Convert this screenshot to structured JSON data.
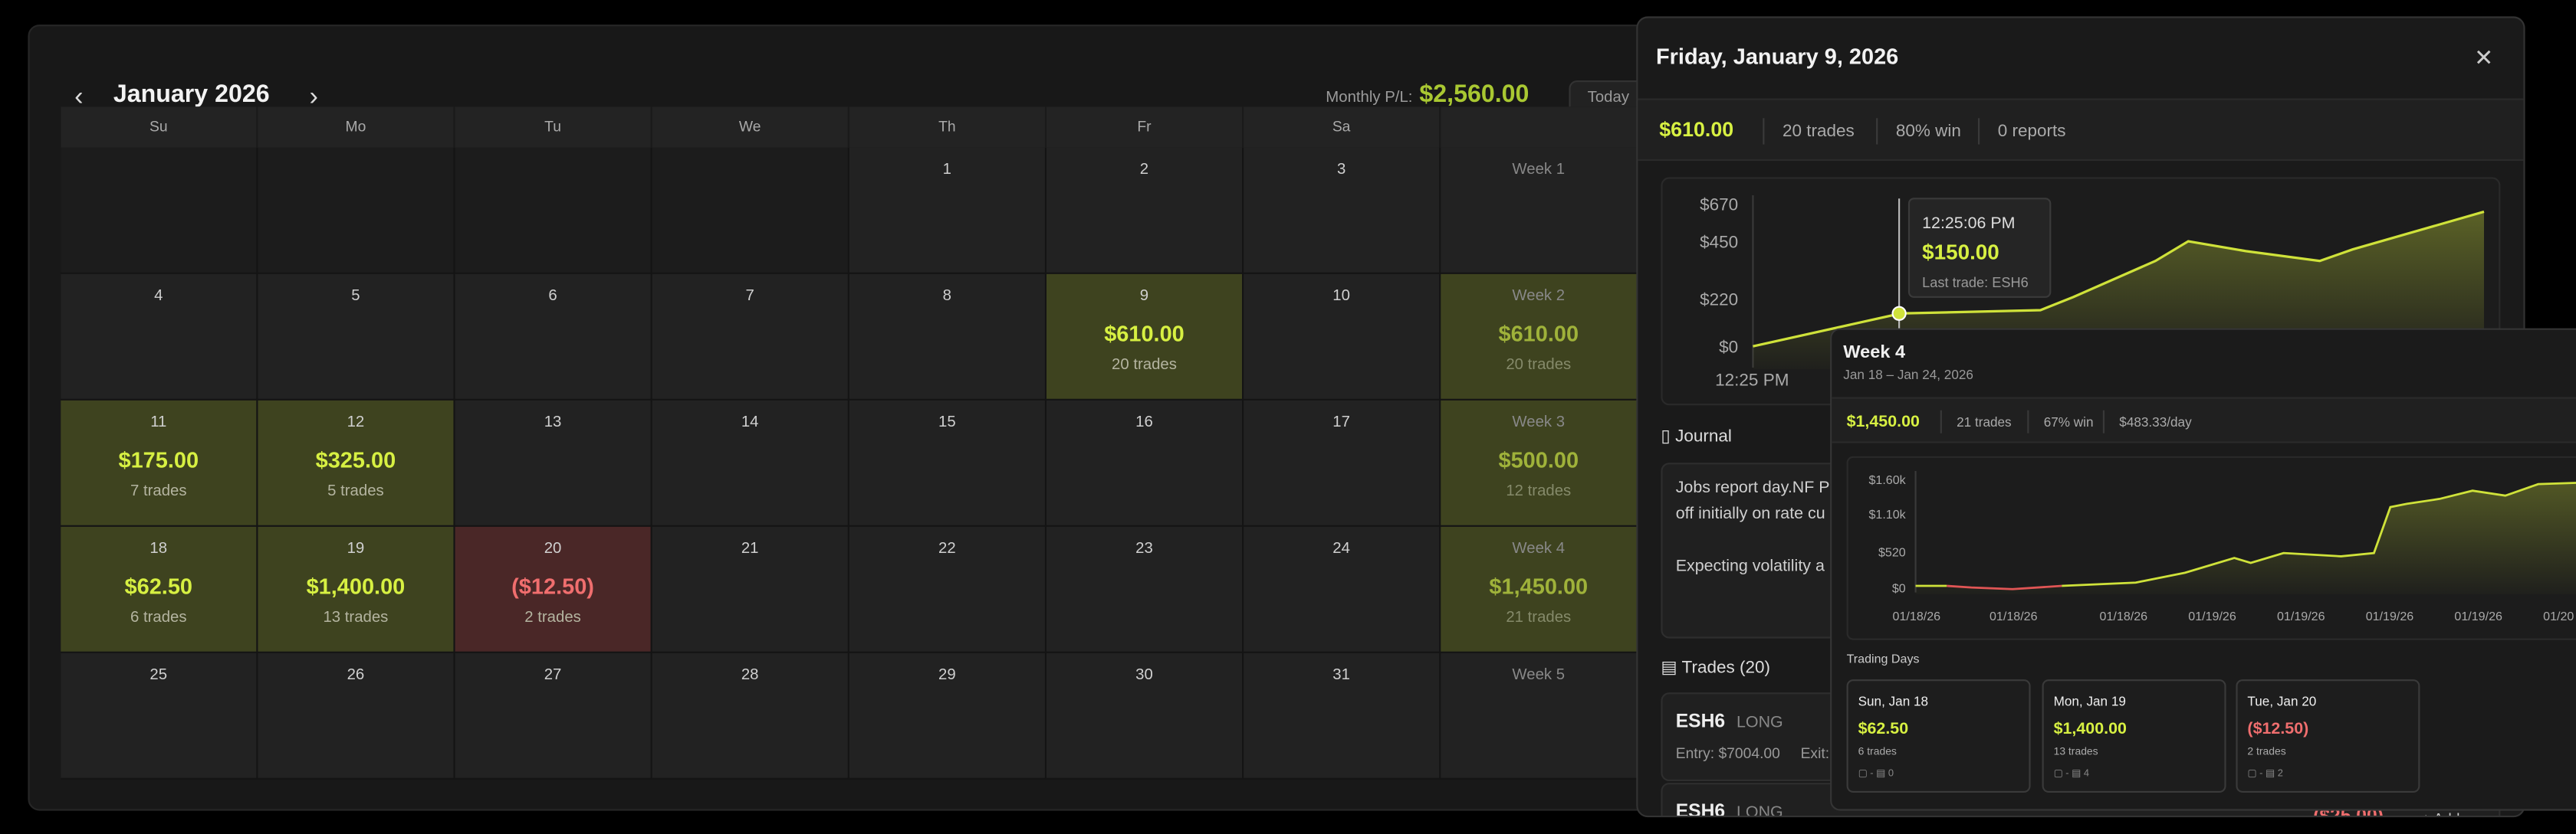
{
  "header": {
    "title": "January 2026",
    "monthly_label": "Monthly P/L:",
    "monthly_value": "$2,560.00",
    "today_label": "Today"
  },
  "weekdays": [
    "Su",
    "Mo",
    "Tu",
    "We",
    "Th",
    "Fr",
    "Sa"
  ],
  "weeks": [
    {
      "days": [
        {
          "n": "",
          "blank": true
        },
        {
          "n": "",
          "blank": true
        },
        {
          "n": "",
          "blank": true
        },
        {
          "n": "",
          "blank": true
        },
        {
          "n": "1"
        },
        {
          "n": "2"
        },
        {
          "n": "3"
        }
      ],
      "summary": {
        "label": "Week 1"
      }
    },
    {
      "days": [
        {
          "n": "4"
        },
        {
          "n": "5"
        },
        {
          "n": "6"
        },
        {
          "n": "7"
        },
        {
          "n": "8"
        },
        {
          "n": "9",
          "amt": "$610.00",
          "trades": "20 trades",
          "type": "pos"
        },
        {
          "n": "10"
        }
      ],
      "summary": {
        "label": "Week 2",
        "amt": "$610.00",
        "trades": "20 trades"
      }
    },
    {
      "days": [
        {
          "n": "11",
          "amt": "$175.00",
          "trades": "7 trades",
          "type": "pos"
        },
        {
          "n": "12",
          "amt": "$325.00",
          "trades": "5 trades",
          "type": "pos"
        },
        {
          "n": "13"
        },
        {
          "n": "14"
        },
        {
          "n": "15"
        },
        {
          "n": "16"
        },
        {
          "n": "17"
        }
      ],
      "summary": {
        "label": "Week 3",
        "amt": "$500.00",
        "trades": "12 trades"
      }
    },
    {
      "days": [
        {
          "n": "18",
          "amt": "$62.50",
          "trades": "6 trades",
          "type": "pos"
        },
        {
          "n": "19",
          "amt": "$1,400.00",
          "trades": "13 trades",
          "type": "pos"
        },
        {
          "n": "20",
          "amt": "($12.50)",
          "trades": "2 trades",
          "type": "neg"
        },
        {
          "n": "21"
        },
        {
          "n": "22"
        },
        {
          "n": "23"
        },
        {
          "n": "24"
        }
      ],
      "summary": {
        "label": "Week 4",
        "amt": "$1,450.00",
        "trades": "21 trades"
      }
    },
    {
      "days": [
        {
          "n": "25"
        },
        {
          "n": "26"
        },
        {
          "n": "27"
        },
        {
          "n": "28"
        },
        {
          "n": "29"
        },
        {
          "n": "30"
        },
        {
          "n": "31"
        }
      ],
      "summary": {
        "label": "Week 5"
      }
    }
  ],
  "day_panel": {
    "title": "Friday, January 9, 2026",
    "pl": "$610.00",
    "trades": "20 trades",
    "win": "80% win",
    "reports": "0 reports",
    "chart": {
      "yticks": [
        "$670",
        "$450",
        "$220",
        "$0"
      ],
      "xticks": [
        "12:25 PM",
        "1"
      ]
    },
    "tooltip": {
      "time": "12:25:06 PM",
      "value": "$150.00",
      "last": "Last trade: ESH6"
    },
    "journal_label": "Journal",
    "journal_lines": [
      "Jobs report day.NF P",
      "off initially on rate cu",
      "",
      "Expecting volatility a"
    ],
    "trades_label": "Trades (20)",
    "trade_rows": [
      {
        "sym": "ESH6",
        "side": "LONG",
        "entry": "Entry: $7004.00",
        "exit": "Exit:"
      },
      {
        "sym": "ESH6",
        "side": "LONG",
        "pl": "($25.00)",
        "add": "+ Add"
      }
    ]
  },
  "week_panel": {
    "title": "Week 4",
    "range": "Jan 18 – Jan 24, 2026",
    "pl": "$1,450.00",
    "trades": "21 trades",
    "win": "67% win",
    "per_day": "$483.33/day",
    "chart": {
      "yticks": [
        "$1.60k",
        "$1.10k",
        "$520",
        "$0"
      ],
      "xticks": [
        "01/18/26",
        "01/18/26",
        "01/18/26",
        "01/19/26",
        "01/19/26",
        "01/19/26",
        "01/19/26",
        "01/20"
      ]
    },
    "days_label": "Trading Days",
    "cards": [
      {
        "date": "Sun, Jan 18",
        "amt": "$62.50",
        "trades": "6 trades",
        "meta": "▢ -   ▤ 0",
        "neg": false
      },
      {
        "date": "Mon, Jan 19",
        "amt": "$1,400.00",
        "trades": "13 trades",
        "meta": "▢ -   ▤ 4",
        "neg": false
      },
      {
        "date": "Tue, Jan 20",
        "amt": "($12.50)",
        "trades": "2 trades",
        "meta": "▢ -   ▤ 2",
        "neg": true
      }
    ]
  },
  "chart_data": [
    {
      "type": "area",
      "title": "",
      "x": [
        "12:25 PM"
      ],
      "series": [
        {
          "values": [
            0,
            150,
            150,
            670
          ]
        }
      ],
      "yticks": [
        "$670",
        "$450",
        "$220",
        "$0"
      ]
    },
    {
      "type": "area",
      "title": "",
      "series": [
        {
          "values": [
            0,
            -12.5,
            62.5,
            1400,
            1450
          ]
        }
      ],
      "yticks": [
        "$1.60k",
        "$1.10k",
        "$520",
        "$0"
      ]
    }
  ]
}
